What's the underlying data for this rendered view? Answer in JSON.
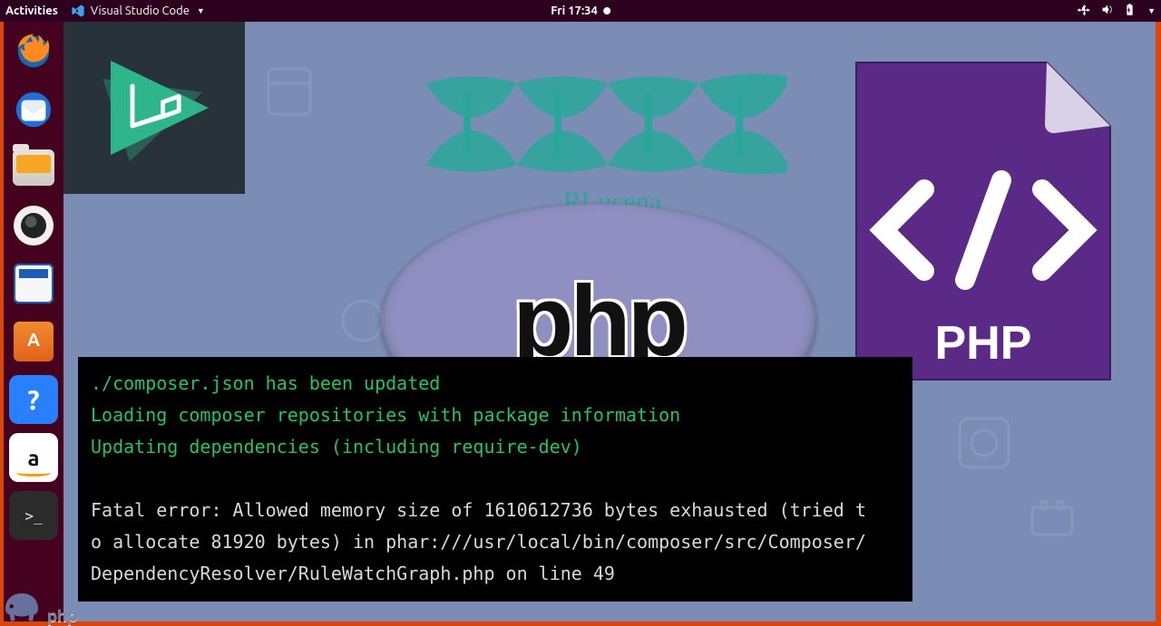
{
  "topbar": {
    "activities": "Activities",
    "app_name": "Visual Studio Code",
    "clock": "Fri 17:34"
  },
  "dock": {
    "firefox": "Firefox",
    "thunderbird": "Thunderbird",
    "files": "Files",
    "rhythmbox": "Rhythmbox",
    "writer": "LibreOffice Writer",
    "software": "Ubuntu Software",
    "help": "?",
    "amazon": "a",
    "terminal": ">_"
  },
  "wallpaper": {
    "brand": "RLucena",
    "php_oval": "php",
    "php_card_label": "PHP",
    "php_card_code": "</>"
  },
  "terminal": {
    "line1": "./composer.json has been updated",
    "line2": "Loading composer repositories with package information",
    "line3": "Updating dependencies (including require-dev)",
    "blank": "",
    "err1": "Fatal error: Allowed memory size of 1610612736 bytes exhausted (tried t",
    "err2": "o allocate 81920 bytes) in phar:///usr/local/bin/composer/src/Composer/",
    "err3": "DependencyResolver/RuleWatchGraph.php on line 49"
  },
  "watermark": {
    "text": "php"
  }
}
